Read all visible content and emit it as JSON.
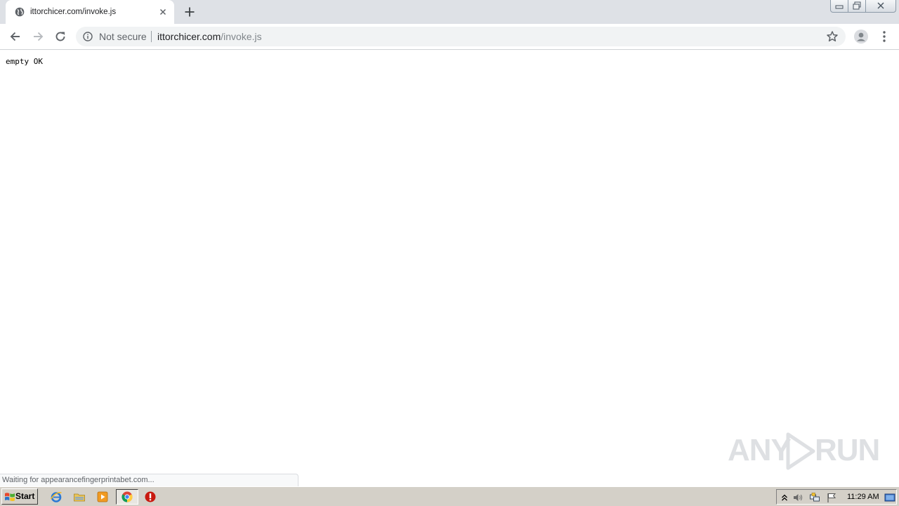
{
  "browser": {
    "tab": {
      "title": "ittorchicer.com/invoke.js",
      "favicon": "globe-icon"
    },
    "omnibox": {
      "security_label": "Not secure",
      "url_host": "ittorchicer.com",
      "url_path": "/invoke.js"
    },
    "status_text": "Waiting for appearancefingerprintabet.com..."
  },
  "page": {
    "body_text": "empty OK"
  },
  "watermark": {
    "left": "ANY",
    "right": "RUN"
  },
  "taskbar": {
    "start_label": "Start",
    "quick_launch": [
      "ie-icon",
      "explorer-icon",
      "media-player-icon"
    ],
    "tasks": [
      "chrome-icon",
      "stop-icon"
    ],
    "tray_icons": [
      "tray-expand-icon",
      "volume-icon",
      "network-icon",
      "flag-icon",
      "show-desktop-icon"
    ],
    "clock": "11:29 AM"
  },
  "colors": {
    "tabstrip": "#dee1e6",
    "omnibox": "#f1f3f4",
    "taskbar": "#d4d0c8"
  }
}
